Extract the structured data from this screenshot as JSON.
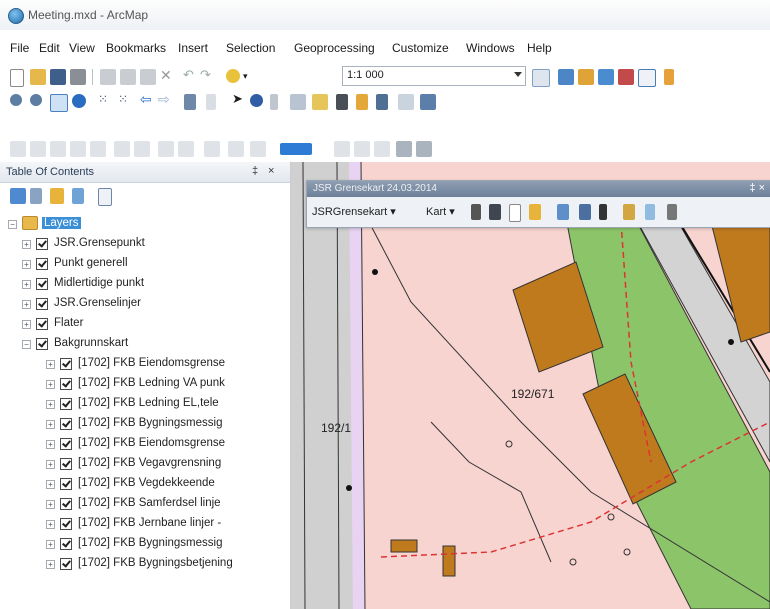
{
  "window": {
    "title": "Meeting.mxd - ArcMap"
  },
  "menu": [
    "File",
    "Edit",
    "View",
    "Bookmarks",
    "Insert",
    "Selection",
    "Geoprocessing",
    "Customize",
    "Windows",
    "Help"
  ],
  "toolbar": {
    "scale_value": "1:1 000"
  },
  "toc": {
    "title": "Table Of Contents",
    "pin_label": "‡",
    "close_label": "×",
    "layers_label": "Layers",
    "items": [
      {
        "label": "JSR.Grensepunkt",
        "expand": "+"
      },
      {
        "label": "Punkt generell",
        "expand": "+"
      },
      {
        "label": "Midlertidige punkt",
        "expand": "+"
      },
      {
        "label": "JSR.Grenselinjer",
        "expand": "+"
      },
      {
        "label": "Flater",
        "expand": "+"
      },
      {
        "label": "Bakgrunnskart",
        "expand": "−"
      }
    ],
    "sub_items": [
      "[1702] FKB Eiendomsgrense",
      "[1702] FKB Ledning VA punk",
      "[1702] FKB Ledning EL,tele",
      "[1702] FKB Bygningsmessig",
      "[1702] FKB Eiendomsgrense",
      "[1702] FKB Vegavgrensning",
      "[1702] FKB Vegdekkeende",
      "[1702] FKB Samferdsel linje",
      "[1702] FKB Jernbane linjer -",
      "[1702] FKB Bygningsmessig",
      "[1702] FKB Bygningsbetjening"
    ]
  },
  "float_window": {
    "title": "JSR Grensekart 24.03.2014",
    "pin": "‡ ×",
    "menu1": "JSRGrensekart ▾",
    "menu2": "Kart ▾"
  },
  "map_labels": {
    "parcel_a": "192/671",
    "parcel_b": "192/1"
  },
  "colors": {
    "accent_selection": "#3a8fd6",
    "map_background": "#f7d4d0",
    "building": "#c07a1e",
    "green_area": "#8cc46a",
    "road": "#d2d2d2"
  }
}
